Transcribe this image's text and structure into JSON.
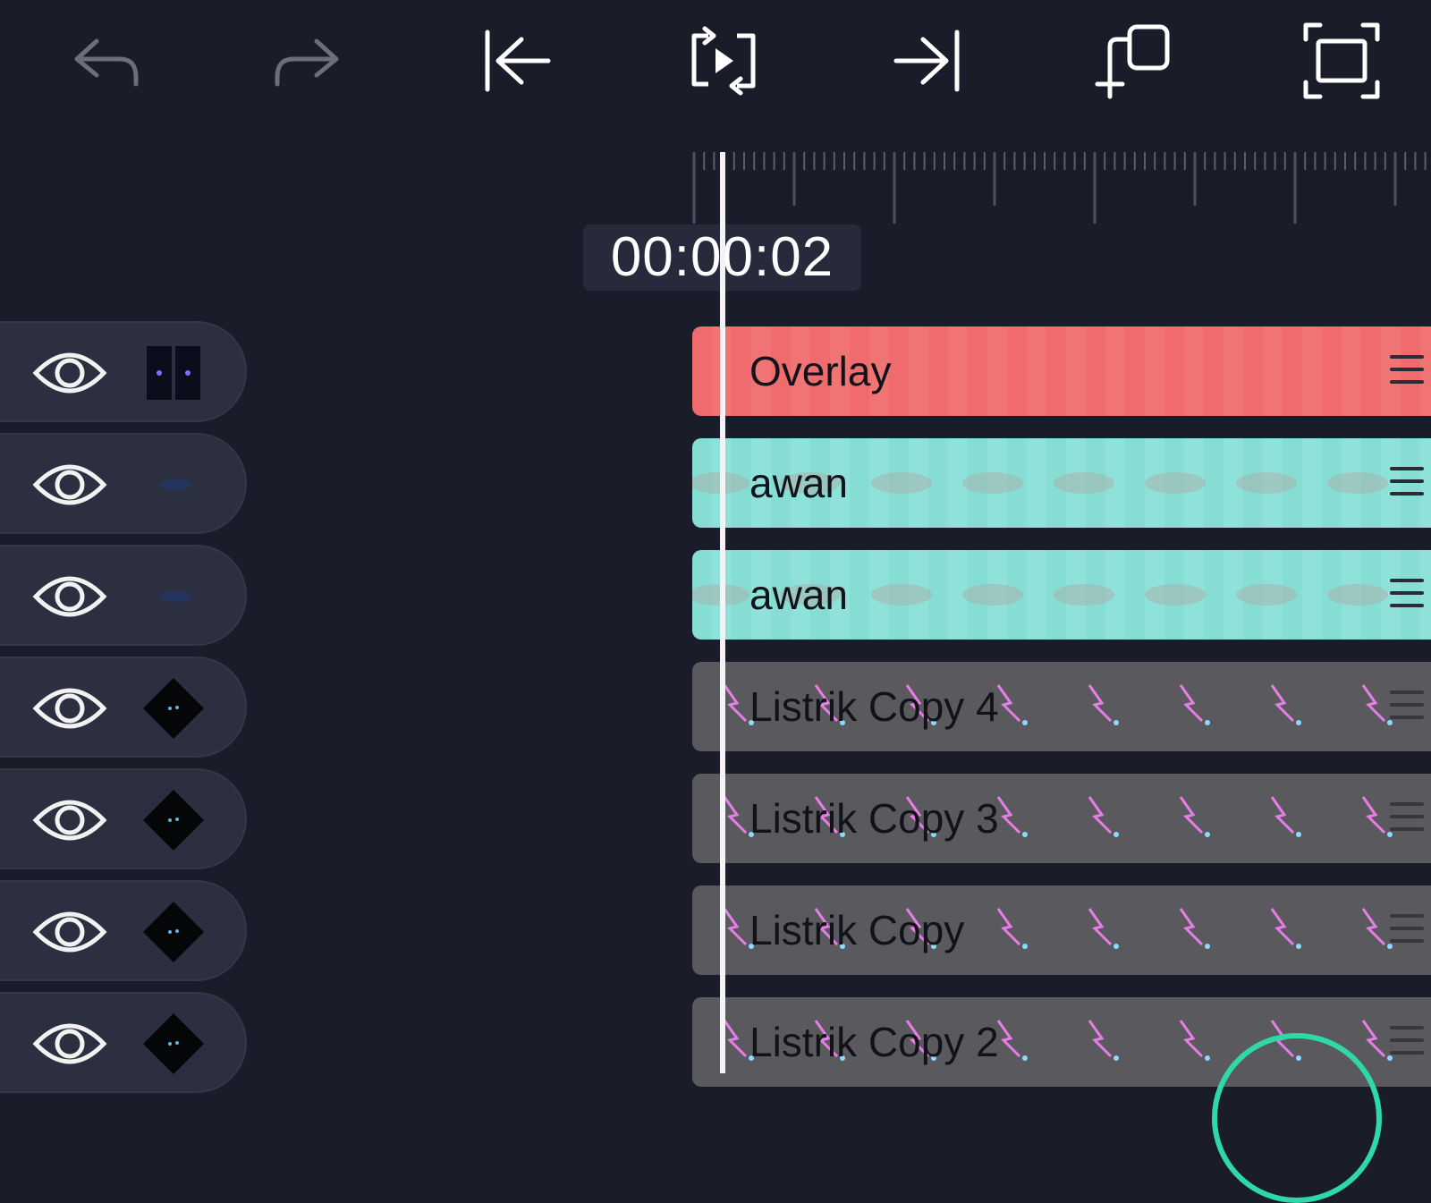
{
  "toolbar": {
    "icons": [
      "undo-icon",
      "redo-icon",
      "jump-to-start-icon",
      "loop-play-icon",
      "jump-to-end-icon",
      "duplicate-add-icon",
      "fullscreen-icon"
    ]
  },
  "playhead": {
    "time": "00:00:02"
  },
  "layers": [
    {
      "name": "Overlay",
      "kind": "overlay",
      "color": "#ef6b6e"
    },
    {
      "name": "awan",
      "kind": "awan",
      "color": "#86ddd4"
    },
    {
      "name": "awan",
      "kind": "awan",
      "color": "#86ddd4"
    },
    {
      "name": "Listrik Copy 4",
      "kind": "fx",
      "color": "#5a5a5e"
    },
    {
      "name": "Listrik Copy 3",
      "kind": "fx",
      "color": "#5a5a5e"
    },
    {
      "name": "Listrik Copy",
      "kind": "fx",
      "color": "#5a5a5e"
    },
    {
      "name": "Listrik Copy 2",
      "kind": "fx",
      "color": "#5a5a5e"
    }
  ],
  "colors": {
    "background": "#1a1d29",
    "accent": "#2fd8a8",
    "playhead": "#f4f4f6"
  }
}
